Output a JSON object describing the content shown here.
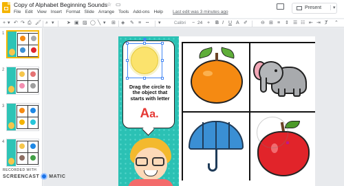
{
  "header": {
    "title": "Copy of Alphabet Beginning Sounds",
    "menu": [
      "File",
      "Edit",
      "View",
      "Insert",
      "Format",
      "Slide",
      "Arrange",
      "Tools",
      "Add-ons",
      "Help"
    ],
    "last_edit": "Last edit was 3 minutes ago",
    "present_label": "Present"
  },
  "toolbar": {
    "font": "Calibri",
    "size": "24"
  },
  "slides_panel": {
    "numbers": [
      "1",
      "2",
      "3",
      "4"
    ]
  },
  "slide": {
    "instruction": "Drag the circle to the object that starts with letter",
    "letter_upper": "A",
    "letter_lower": "a",
    "letter_dot": ".",
    "cells": [
      "orange",
      "elephant",
      "umbrella",
      "apple"
    ]
  },
  "watermark": {
    "top": "RECORDED WITH",
    "left": "SCREENCAST",
    "right": "MATIC"
  },
  "colors": {
    "accent": "#f4b400",
    "teal_strip": "#2bc1b4",
    "letter_red": "#e53935",
    "selection": "#4285f4"
  }
}
